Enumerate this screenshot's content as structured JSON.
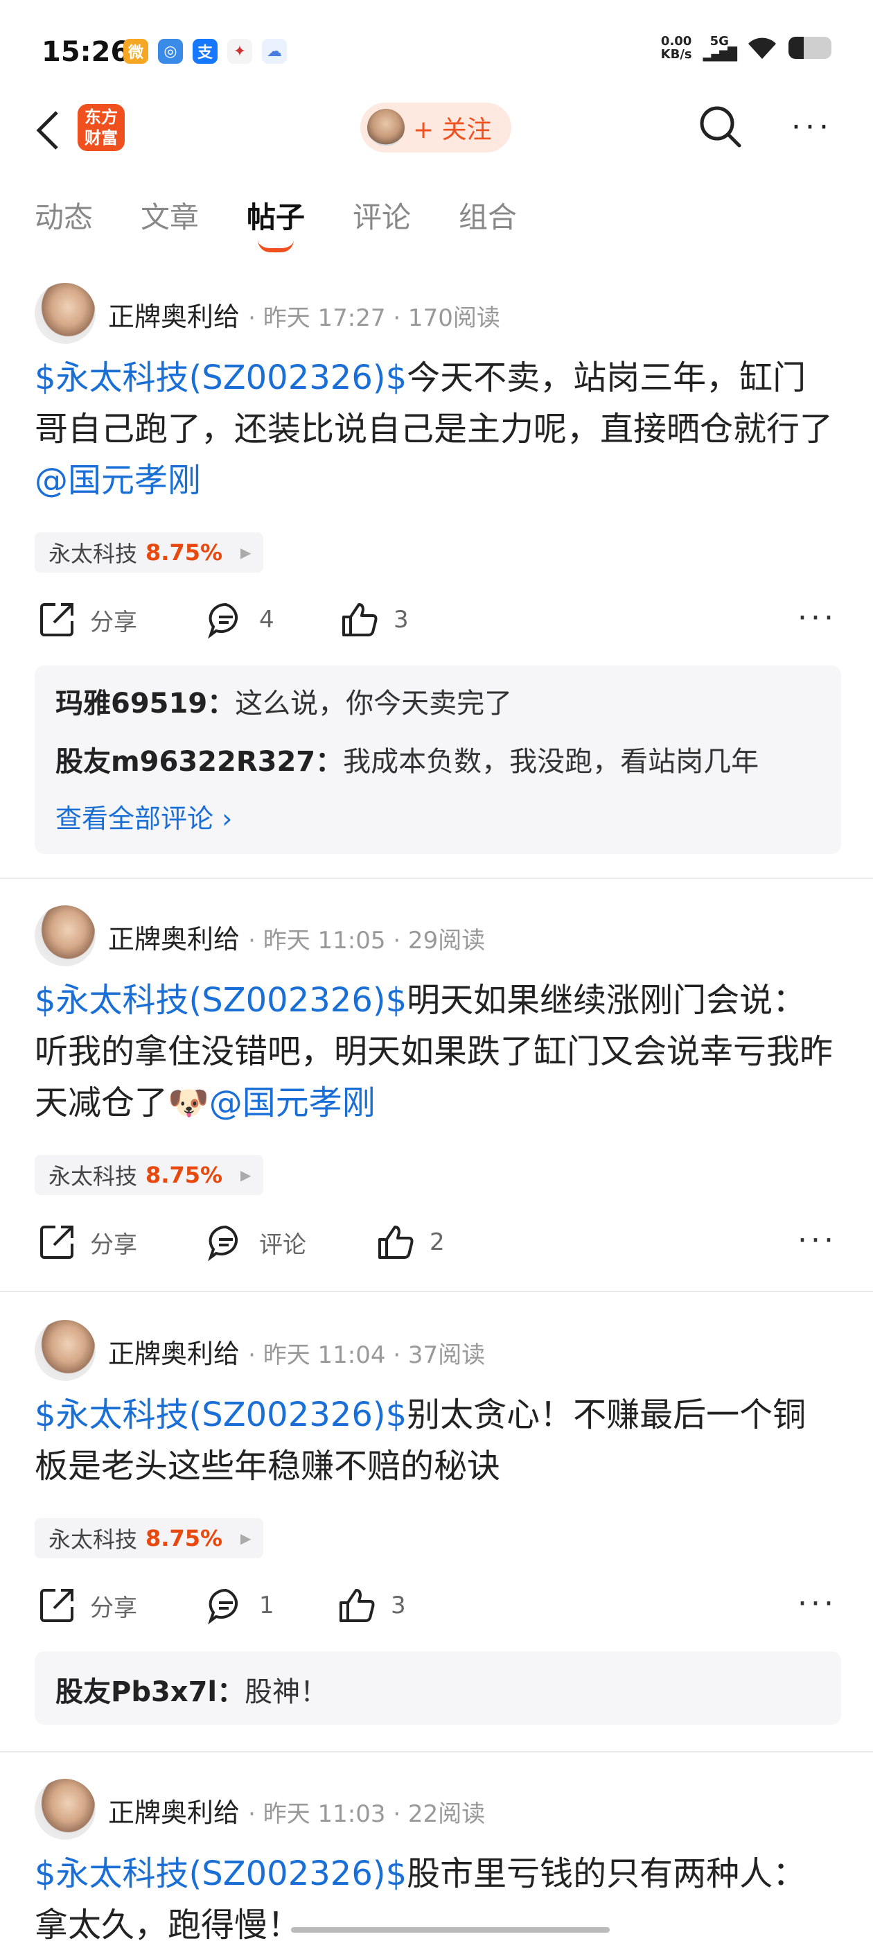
{
  "status": {
    "time": "15:26",
    "net_speed": "0.00",
    "net_unit": "KB/s",
    "network": "5G",
    "battery_level": 0.35
  },
  "nav": {
    "logo": "东方财富",
    "follow_label": "+ 关注"
  },
  "tabs": [
    {
      "label": "动态"
    },
    {
      "label": "文章"
    },
    {
      "label": "帖子"
    },
    {
      "label": "评论"
    },
    {
      "label": "组合"
    }
  ],
  "posts": [
    {
      "author": "正牌奥利给",
      "meta": "· 昨天 17:27 · 170阅读",
      "stock_link": "$永太科技(SZ002326)$",
      "text": "今天不卖，站岗三年，缸门哥自己跑了，还装比说自己是主力呢，直接晒仓就行了",
      "mention": "@国元孝刚",
      "tag_name": "永太科技",
      "tag_pct": "8.75%",
      "share": "分享",
      "comments": "4",
      "likes": "3",
      "replies": [
        {
          "user": "玛雅69519：",
          "text": "这么说，你今天卖完了"
        },
        {
          "user": "股友m96322R327：",
          "text": "我成本负数，我没跑，看站岗几年"
        }
      ],
      "view_all": "查看全部评论 ›"
    },
    {
      "author": "正牌奥利给",
      "meta": "· 昨天 11:05 · 29阅读",
      "stock_link": "$永太科技(SZ002326)$",
      "text": "明天如果继续涨刚门会说：听我的拿住没错吧，明天如果跌了缸门又会说幸亏我昨天减仓了🐶",
      "mention": "@国元孝刚",
      "tag_name": "永太科技",
      "tag_pct": "8.75%",
      "share": "分享",
      "comments": "评论",
      "likes": "2"
    },
    {
      "author": "正牌奥利给",
      "meta": "· 昨天 11:04 · 37阅读",
      "stock_link": "$永太科技(SZ002326)$",
      "text": "别太贪心！不赚最后一个铜板是老头这些年稳赚不赔的秘诀",
      "tag_name": "永太科技",
      "tag_pct": "8.75%",
      "share": "分享",
      "comments": "1",
      "likes": "3",
      "replies": [
        {
          "user": "股友Pb3x7l：",
          "text": "股神！"
        }
      ]
    },
    {
      "author": "正牌奥利给",
      "meta": "· 昨天 11:03 · 22阅读",
      "stock_link": "$永太科技(SZ002326)$",
      "text": "股市里亏钱的只有两种人：拿太久，跑得慢！"
    }
  ]
}
